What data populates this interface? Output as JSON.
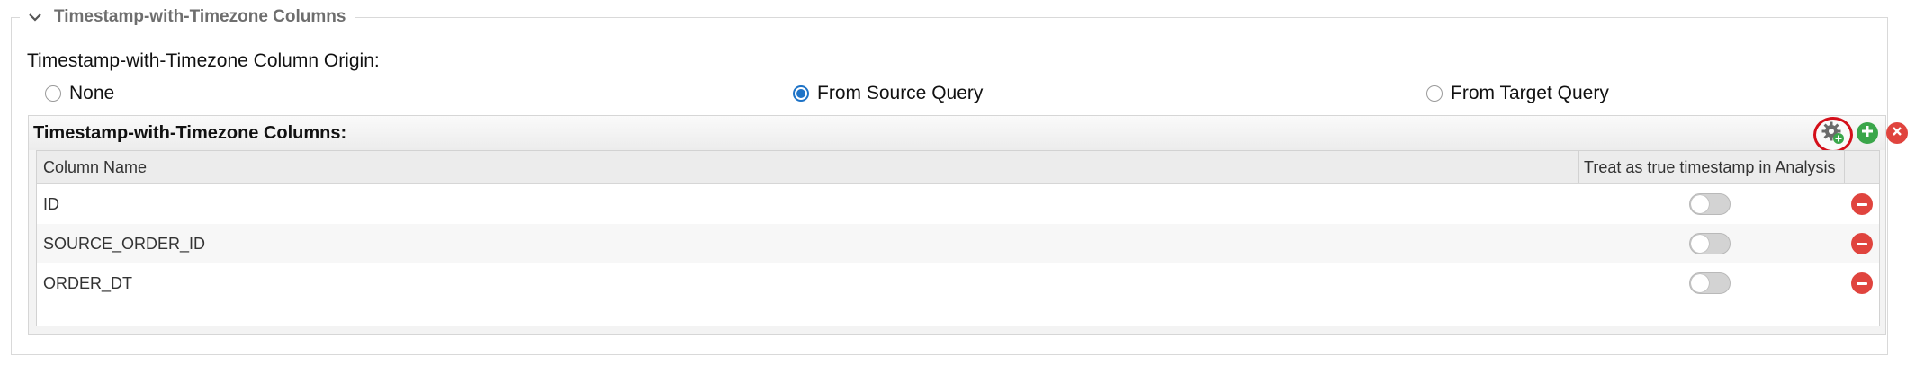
{
  "section": {
    "title": "Timestamp-with-Timezone Columns",
    "origin_label": "Timestamp-with-Timezone Column Origin:",
    "origin_options": [
      {
        "label": "None",
        "checked": false
      },
      {
        "label": "From Source Query",
        "checked": true
      },
      {
        "label": "From Target Query",
        "checked": false
      }
    ]
  },
  "panel": {
    "title": "Timestamp-with-Timezone Columns:",
    "buttons": {
      "settings_icon": "gear-plus-icon",
      "add_icon": "plus-icon",
      "close_icon": "x-icon"
    },
    "columns": [
      "Column Name",
      "Treat as true timestamp in Analysis"
    ],
    "rows": [
      {
        "name": "ID",
        "true_timestamp": false
      },
      {
        "name": "SOURCE_ORDER_ID",
        "true_timestamp": false
      },
      {
        "name": "ORDER_DT",
        "true_timestamp": false
      }
    ]
  },
  "colors": {
    "accent_radio": "#1e73c7",
    "add": "#3aa64a",
    "remove": "#e0443e",
    "highlight_ring": "#d40f1a"
  }
}
